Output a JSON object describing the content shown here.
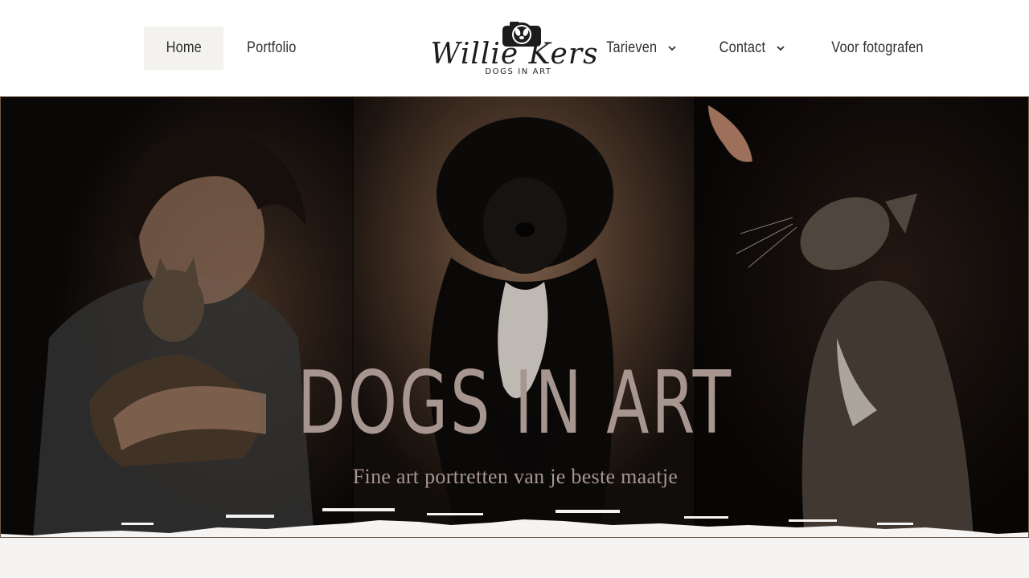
{
  "nav": {
    "left": [
      {
        "label": "Home",
        "active": true
      },
      {
        "label": "Portfolio",
        "active": false
      }
    ],
    "right": [
      {
        "label": "Tarieven",
        "has_dropdown": true
      },
      {
        "label": "Contact",
        "has_dropdown": true
      },
      {
        "label": "Voor fotografen",
        "has_dropdown": false
      }
    ]
  },
  "logo": {
    "script": "Willie Kers",
    "tagline": "DOGS IN ART",
    "icon": "camera-dog-icon"
  },
  "hero": {
    "title": "DOGS IN ART",
    "subtitle": "Fine art portretten van je beste maatje",
    "panels": [
      {
        "name": "man-with-cat-photo"
      },
      {
        "name": "curly-black-dog-photo"
      },
      {
        "name": "cat-with-leaf-photo"
      }
    ]
  },
  "colors": {
    "header_bg": "#ffffff",
    "active_nav_bg": "#f3f2ef",
    "nav_text": "#2f2f2f",
    "hero_text": "#a7958f",
    "page_bg": "#f5f4f2"
  }
}
